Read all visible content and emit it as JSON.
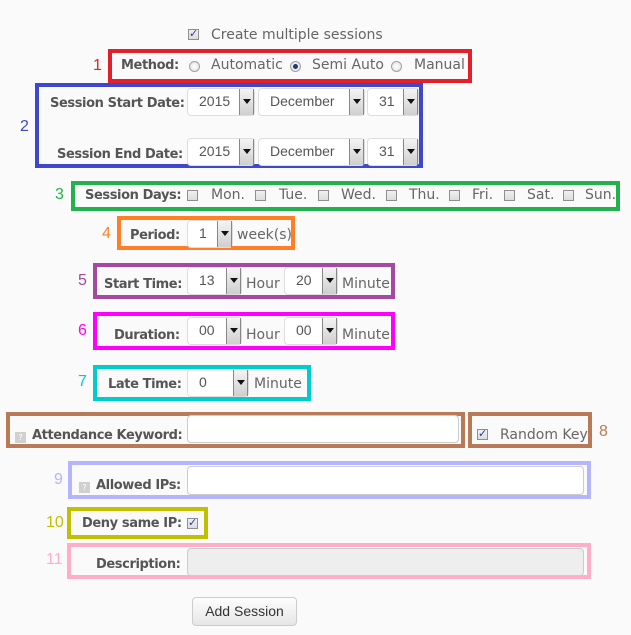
{
  "create_multiple": {
    "label": "Create multiple sessions",
    "checked": true
  },
  "method": {
    "number": "1",
    "label": "Method:",
    "options": [
      "Automatic",
      "Semi Auto",
      "Manual"
    ],
    "selected": "Semi Auto",
    "color": "#e3202a"
  },
  "dates": {
    "number": "2",
    "color": "#3f48cc",
    "start": {
      "label": "Session Start Date:",
      "year": "2015",
      "month": "December",
      "day": "31"
    },
    "end": {
      "label": "Session End Date:",
      "year": "2015",
      "month": "December",
      "day": "31"
    }
  },
  "session_days": {
    "number": "3",
    "label": "Session Days:",
    "color": "#22b14c",
    "days": [
      {
        "label": "Mon.",
        "checked": false
      },
      {
        "label": "Tue.",
        "checked": false
      },
      {
        "label": "Wed.",
        "checked": false
      },
      {
        "label": "Thu.",
        "checked": false
      },
      {
        "label": "Fri.",
        "checked": false
      },
      {
        "label": "Sat.",
        "checked": false
      },
      {
        "label": "Sun.",
        "checked": false
      }
    ]
  },
  "period": {
    "number": "4",
    "label": "Period:",
    "value": "1",
    "unit": "week(s)",
    "color": "#ff7f27"
  },
  "start_time": {
    "number": "5",
    "label": "Start Time:",
    "hour": "13",
    "hour_unit": "Hour",
    "minute": "20",
    "minute_unit": "Minute",
    "color": "#a349a4"
  },
  "duration": {
    "number": "6",
    "label": "Duration:",
    "hour": "00",
    "hour_unit": "Hour",
    "minute": "00",
    "minute_unit": "Minute",
    "color": "#ff00ff"
  },
  "late_time": {
    "number": "7",
    "label": "Late Time:",
    "value": "0",
    "unit": "Minute",
    "color": "#00cccc"
  },
  "keyword": {
    "label": "Attendance Keyword:",
    "value": "",
    "help": "?",
    "color": "#b97a57"
  },
  "random_key": {
    "number": "8",
    "label": "Random Key",
    "checked": true,
    "color": "#b97a57"
  },
  "allowed_ips": {
    "number": "9",
    "label": "Allowed IPs:",
    "value": "",
    "help": "?",
    "color": "#b4b4ff"
  },
  "deny_same_ip": {
    "number": "10",
    "label": "Deny same IP:",
    "checked": true,
    "color": "#c0c000"
  },
  "description": {
    "number": "11",
    "label": "Description:",
    "value": "",
    "color": "#ffaec9"
  },
  "submit": {
    "label": "Add Session"
  }
}
